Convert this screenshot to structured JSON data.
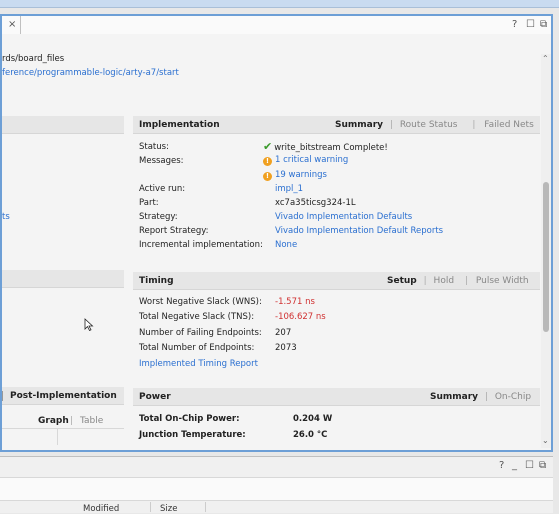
{
  "window": {
    "close_glyph": "×",
    "help_glyph": "?",
    "restore_glyph": "☐",
    "float_glyph": "⧉"
  },
  "paths": {
    "board_files": "rds/board_files",
    "board_link": "ference/programmable-logic/arty-a7/start"
  },
  "left_partial": {
    "link_ts": "ts",
    "post_impl_label": "Post-Implementation",
    "graph_label": "Graph",
    "table_label": "Table"
  },
  "implementation": {
    "title": "Implementation",
    "tabs": [
      "Summary",
      "Route Status",
      "Failed Nets"
    ],
    "status_label": "Status:",
    "status_value": "write_bitstream Complete!",
    "messages_label": "Messages:",
    "critical_warning": "1 critical warning",
    "warnings": "19 warnings",
    "active_run_label": "Active run:",
    "active_run_value": "impl_1",
    "part_label": "Part:",
    "part_value": "xc7a35ticsg324-1L",
    "strategy_label": "Strategy:",
    "strategy_value": "Vivado Implementation Defaults",
    "report_strategy_label": "Report Strategy:",
    "report_strategy_value": "Vivado Implementation Default Reports",
    "incremental_label": "Incremental implementation:",
    "incremental_value": "None"
  },
  "timing": {
    "title": "Timing",
    "tabs": [
      "Setup",
      "Hold",
      "Pulse Width"
    ],
    "wns_label": "Worst Negative Slack (WNS):",
    "wns_value": "-1.571 ns",
    "tns_label": "Total Negative Slack (TNS):",
    "tns_value": "-106.627 ns",
    "failing_label": "Number of Failing Endpoints:",
    "failing_value": "207",
    "total_endpoints_label": "Total Number of Endpoints:",
    "total_endpoints_value": "2073",
    "report_link": "Implemented Timing Report"
  },
  "power": {
    "title": "Power",
    "tabs": [
      "Summary",
      "On-Chip"
    ],
    "total_label": "Total On-Chip Power:",
    "total_value": "0.204 W",
    "junction_label": "Junction Temperature:",
    "junction_value": "26.0 °C"
  },
  "bottom": {
    "help_glyph": "?",
    "min_glyph": "_",
    "restore_glyph": "☐",
    "float_glyph": "⧉",
    "col_modified": "Modified",
    "col_size": "Size"
  },
  "colors": {
    "accent": "#6d9fd6",
    "link": "#2a6fd0",
    "error": "#d03030",
    "ok": "#3a9a2a",
    "warn": "#f0a020"
  }
}
